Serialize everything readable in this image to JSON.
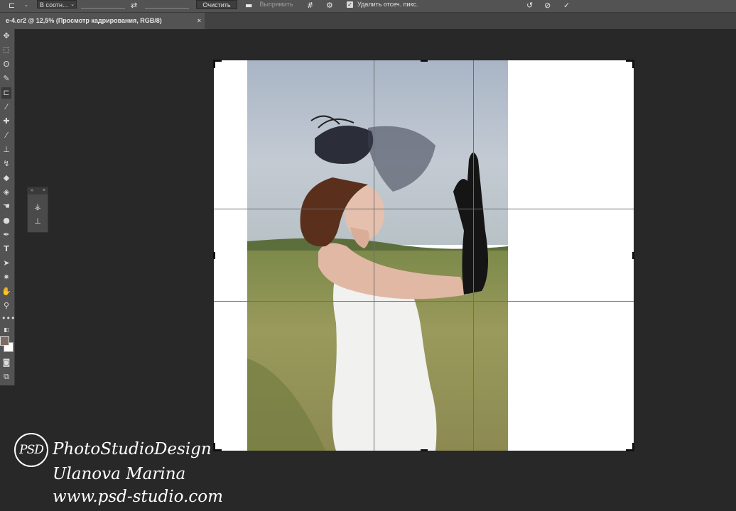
{
  "options_bar": {
    "crop_icon": "crop-icon",
    "ratio_select": "В соотн...",
    "swap_icon": "swap-icon",
    "clear_button": "Очистить",
    "straighten_icon": "level-icon",
    "straighten_button": "Выпрямить",
    "overlay_icon": "grid-overlay-icon",
    "settings_icon": "gear-icon",
    "delete_cropped_checked": true,
    "delete_cropped_label": "Удалить отсеч. пикс.",
    "reset_icon": "reset-icon",
    "cancel_icon": "cancel-icon",
    "commit_icon": "checkmark-icon"
  },
  "document_tab": {
    "title": "e-4.cr2 @ 12,5% (Просмотр кадрирования, RGB/8)",
    "close": "×"
  },
  "toolbox": {
    "tools": [
      "move",
      "marquee",
      "lasso",
      "quick-select",
      "crop",
      "eyedropper",
      "healing-brush",
      "brush",
      "clone-stamp",
      "history-brush",
      "eraser",
      "paint-bucket",
      "smudge",
      "dodge",
      "pen",
      "type",
      "path-select",
      "custom-shape",
      "hand",
      "zoom",
      "more"
    ],
    "active_tool": "crop",
    "foreground_color": "#7d6a60",
    "background_color": "#ffffff"
  },
  "watermark": {
    "logo": "PSD",
    "line1": "PhotoStudioDesign",
    "line2": "Ulanova Marina",
    "line3": "www.psd-studio.com"
  },
  "colors": {
    "workspace": "#282828",
    "panel": "#535353",
    "canvas_fill": "#ffffff"
  }
}
